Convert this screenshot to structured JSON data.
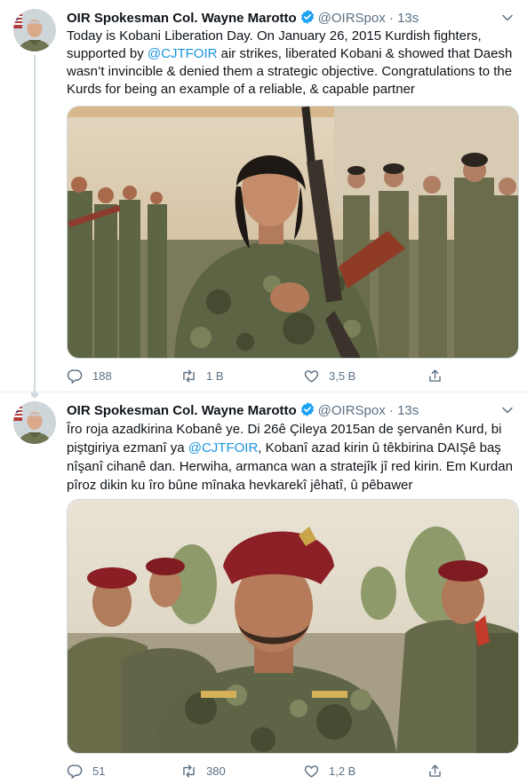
{
  "tweets": [
    {
      "author_name": "OIR Spokesman Col. Wayne Marotto",
      "author_handle": "@OIRSpox",
      "separator": "·",
      "time": "13s",
      "text_parts": [
        "Today is Kobani Liberation Day. On January 26, 2015 Kurdish fighters, supported by ",
        "@CJTFOIR",
        " air strikes, liberated  Kobani & showed that Daesh wasn’t invincible & denied them a strategic objective. Congratulations to the Kurds for being an example of a reliable, & capable partner"
      ],
      "image_icon": "photo-female-fighters",
      "reply_count": "188",
      "retweet_count": "1 B",
      "like_count": "3,5 B"
    },
    {
      "author_name": "OIR Spokesman Col. Wayne Marotto",
      "author_handle": "@OIRSpox",
      "separator": "·",
      "time": "13s",
      "text_parts": [
        "Îro roja azadkirina Kobanê ye. Di 26ê Çileya 2015an de şervanên Kurd, bi piştgiriya ezmanî ya ",
        "@CJTFOIR",
        ", Kobanî azad kirin û têkbirina DAIŞê baş nîşanî cihanê dan. Herwiha, armanca wan a stratejîk jî red kirin. Em Kurdan pîroz dikin ku îro bûne mînaka hevkarekî jêhatî, û pêbawer"
      ],
      "image_icon": "photo-peshmerga-soldiers",
      "reply_count": "51",
      "retweet_count": "380",
      "like_count": "1,2 B"
    }
  ],
  "colors": {
    "text": "#0f1419",
    "secondary": "#5b7083",
    "link": "#1b95e0",
    "verified": "#1da1f2",
    "thread_line": "#cfd9de"
  }
}
